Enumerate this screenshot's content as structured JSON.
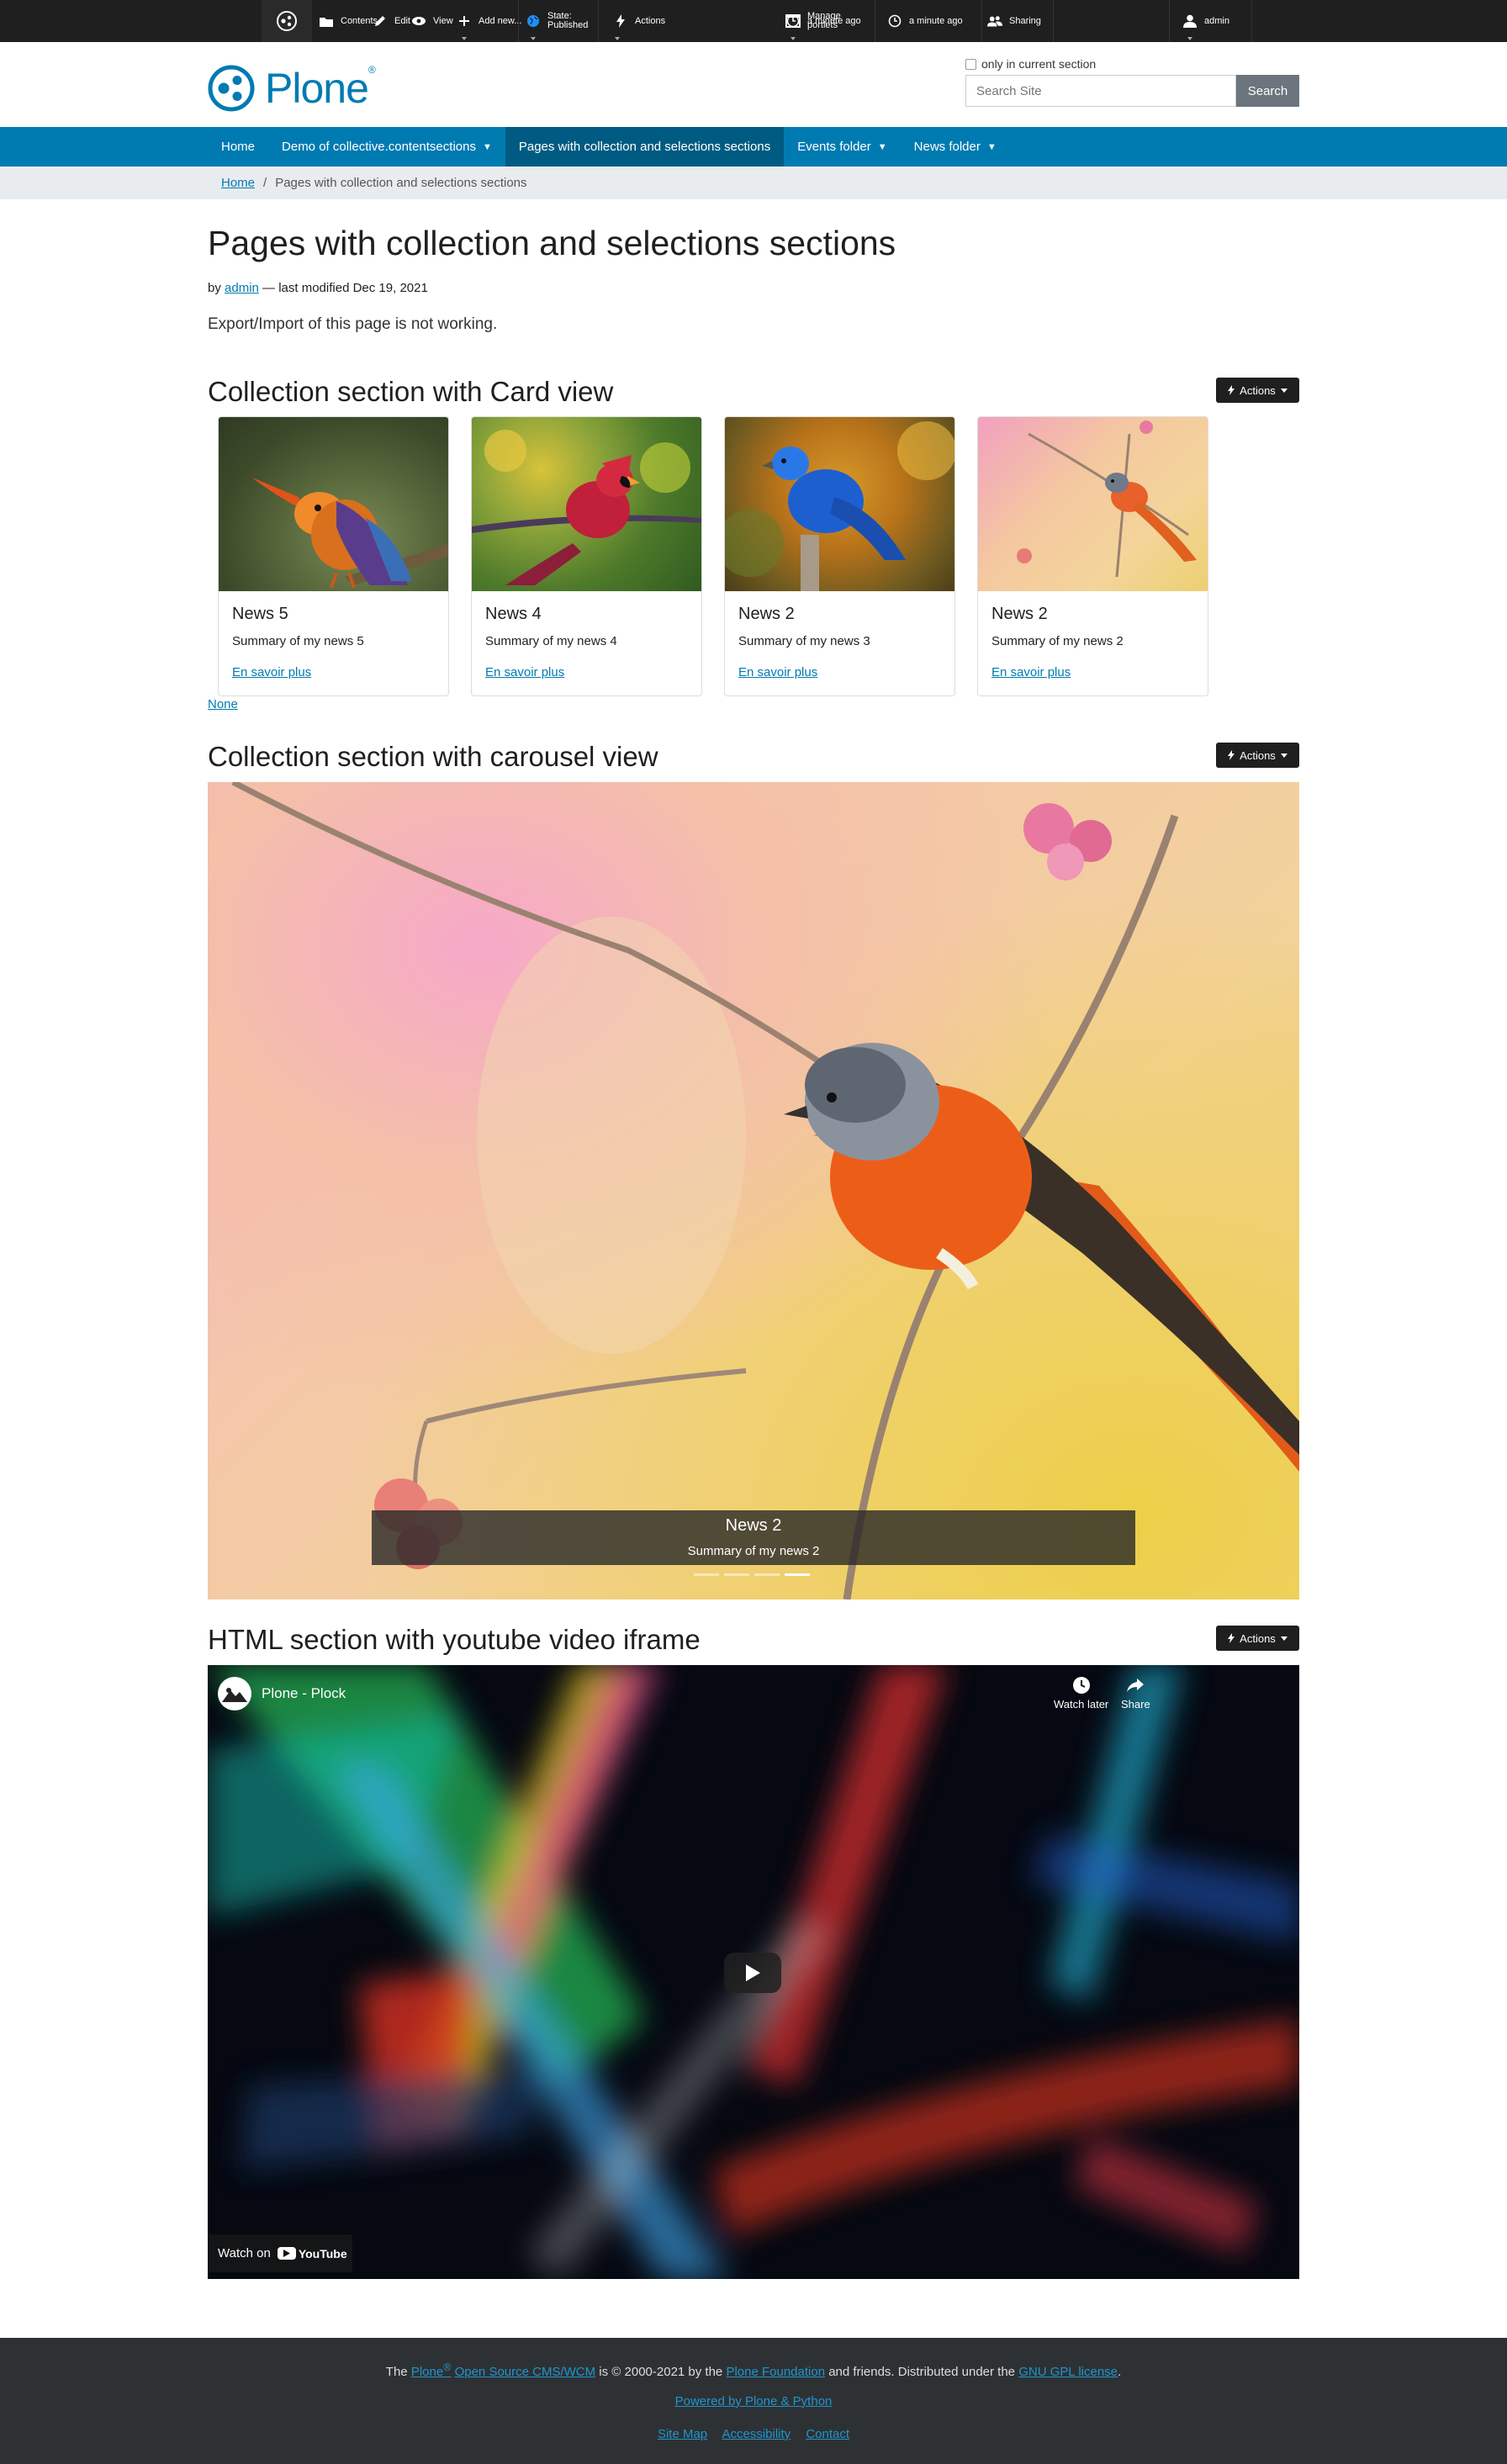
{
  "toolbar": {
    "contents": "Contents",
    "edit": "Edit",
    "view": "View",
    "add_new": "Add new...",
    "state_line1": "State:",
    "state_line2": "Published",
    "actions": "Actions",
    "manage_line1": "Manage",
    "manage_line2": "portlets",
    "history": "a minute ago",
    "sharing": "Sharing",
    "user": "admin"
  },
  "header": {
    "logo_text": "Plone",
    "logo_mark": "®",
    "search_checkbox_label": "only in current section",
    "search_placeholder": "Search Site",
    "search_button": "Search"
  },
  "nav": {
    "items": [
      {
        "label": "Home"
      },
      {
        "label": "Demo of collective.contentsections",
        "caret": "▼"
      },
      {
        "label": "Pages with collection and selections sections"
      },
      {
        "label": "Events folder",
        "caret": "▼"
      },
      {
        "label": "News folder",
        "caret": "▼"
      }
    ]
  },
  "breadcrumb": {
    "home": "Home",
    "separator": "/",
    "current": "Pages with collection and selections sections"
  },
  "page": {
    "title": "Pages with collection and selections sections",
    "by": "by",
    "author": "admin",
    "modified": "— last modified Dec 19, 2021",
    "description": "Export/Import of this page is not working."
  },
  "sections": {
    "actions_label": "Actions",
    "card_title": "Collection section with Card view",
    "carousel_title": "Collection section with carousel view",
    "html_title": "HTML section with youtube video iframe"
  },
  "cards": [
    {
      "title": "News 5",
      "summary": "Summary of my news 5",
      "link": "En savoir plus"
    },
    {
      "title": "News 4",
      "summary": "Summary of my news 4",
      "link": "En savoir plus"
    },
    {
      "title": "News 2",
      "summary": "Summary of my news 3",
      "link": "En savoir plus"
    },
    {
      "title": "News 2",
      "summary": "Summary of my news 2",
      "link": "En savoir plus"
    }
  ],
  "none_link": "None",
  "carousel": {
    "caption_title": "News 2",
    "caption_summary": "Summary of my news 2",
    "slide_count": 4,
    "active_slide": 4
  },
  "video": {
    "title": "Plone - Plock",
    "watch_later": "Watch later",
    "share": "Share",
    "watch_on": "Watch on",
    "youtube": "YouTube"
  },
  "footer": {
    "line1_pre": "The",
    "plone": "Plone",
    "reg": "®",
    "oss": "Open Source CMS/WCM",
    "line1_mid": "is © 2000-2021 by the",
    "foundation": "Plone Foundation",
    "line1_post": "and friends. Distributed under the",
    "license": "GNU GPL license",
    "line1_end": ".",
    "powered": "Powered by Plone & Python",
    "sitemap": "Site Map",
    "accessibility": "Accessibility",
    "contact": "Contact"
  },
  "colors": {
    "brand": "#007bb1",
    "nav_current": "#005b82",
    "toolbar": "#1f1f1f",
    "footer": "#2e3133"
  }
}
